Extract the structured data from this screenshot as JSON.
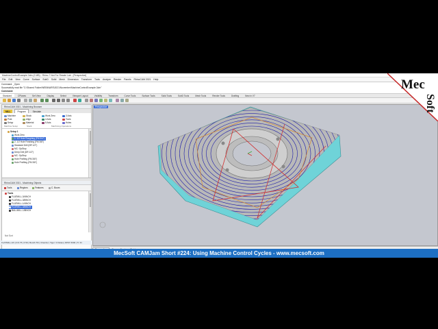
{
  "window": {
    "title": "MachineControlExample.3dm (2 MB) - Rhino 7 Not For Resale Lab - [Perspective]"
  },
  "menu": [
    "File",
    "Edit",
    "View",
    "Curve",
    "Surface",
    "SubD",
    "Solid",
    "Mesh",
    "Dimension",
    "Transform",
    "Tools",
    "Analyze",
    "Render",
    "Panels",
    "RhinoCAM 2021",
    "Help"
  ],
  "command": {
    "line1": "Command: _Open",
    "line2": "Successfully read file \"C:\\Shared Folder\\WEBINARS\\2021\\November\\MachineControlExample.3dm\"",
    "prompt": "Command:"
  },
  "toolbar_tabs": [
    "Standard",
    "CPlanes",
    "Set View",
    "Display",
    "Select",
    "Viewport Layout",
    "Visibility",
    "Transform",
    "Curve Tools",
    "Surface Tools",
    "Solid Tools",
    "SubD Tools",
    "Mesh Tools",
    "Render Tools",
    "Drafting",
    "New in V7"
  ],
  "toolbar_active": "Standard",
  "browser": {
    "title": "RhinoCAM 2021 - Machining Browser",
    "tabs": [
      "MILL",
      "Program",
      "Simulate"
    ],
    "ribbon": {
      "machine": "Machine",
      "stock": "Stock",
      "wcs": "Work Zero",
      "axis3": "3 Axis",
      "post": "Post",
      "align": "Align",
      "axis4": "4 Axis",
      "tools": "Tools",
      "setup": "Setup",
      "material": "Material",
      "axis5": "5 Axis",
      "holes": "Holes",
      "group1": "Machine Setup",
      "group2": "Stock",
      "group3": "Machining Operations"
    },
    "tree": {
      "setup": "Setup 1",
      "wcs": "Work Zero",
      "items": [
        "1. 1/2 Hole Roughing (FM 3/4\")",
        "2. 1/2 Hole Finishing (FM 3/8\")",
        "Standard Drill (DR 1/2\")",
        "MC: OpStop",
        "Deep Drill (DR 1/2\")",
        "MC: OpStop",
        "Hole Profiling (FM 3/8\")",
        "Hole Profiling (FM 3/8\")"
      ]
    }
  },
  "objects": {
    "title": "RhinoCAM 2021 - Machining Objects",
    "buttons": [
      "Tools",
      "Regions",
      "Features",
      "C. Boom"
    ],
    "tools_label": "Tools",
    "tools": [
      "FLATMILL-3/4INCH",
      "FLATMILL-3/8INCH",
      "FLATMILL-1/4INCH",
      "FLATMILL-3/8INCH",
      "BALLMILL-1/8INCH"
    ],
    "sort_label": "Not Sort"
  },
  "viewport": {
    "label": "Perspective",
    "tabs": [
      "Perspective",
      "Top",
      "Front",
      "Right"
    ],
    "active_tab": "Perspective"
  },
  "status_strip": "FLATMILL-3/4 | D:0.75 | F:50 | Bore5.7IN | Chamfer | Tiger: 3 Fluties | RPM: 5000 | Ti: IN",
  "osnap": [
    "End",
    "Near",
    "Point",
    "Mid",
    "Cen",
    "Int",
    "Perp",
    "Tan",
    "Quad",
    "Knot",
    "Vertex",
    "Project",
    "Disable"
  ],
  "statusbar": {
    "cplane": "World",
    "x": "x -7.451",
    "y": "y 21.746",
    "z": "z 0.000",
    "units": "Inches",
    "layer": "Layer 01",
    "modes": [
      "Grid Snap",
      "Ortho",
      "Planar",
      "Osnap",
      "SmartTrack",
      "Gumball",
      "Record History",
      "Filter"
    ],
    "absolute": "Absolute tolerance: 0.001"
  },
  "logo": {
    "line1": "Mec",
    "line2": "Soft"
  },
  "banner": {
    "text": "MecSoft CAMJam Short #224: Using Machine Control Cycles - www.mecsoft.com"
  },
  "colors": {
    "banner": "#1d6fc3",
    "viewport_bg": "#c4c7cf",
    "toolpath": "#1a1aa8",
    "stock": "#6fd3d8",
    "part": "#b9b9b9",
    "selection": "#3d6fd8"
  }
}
